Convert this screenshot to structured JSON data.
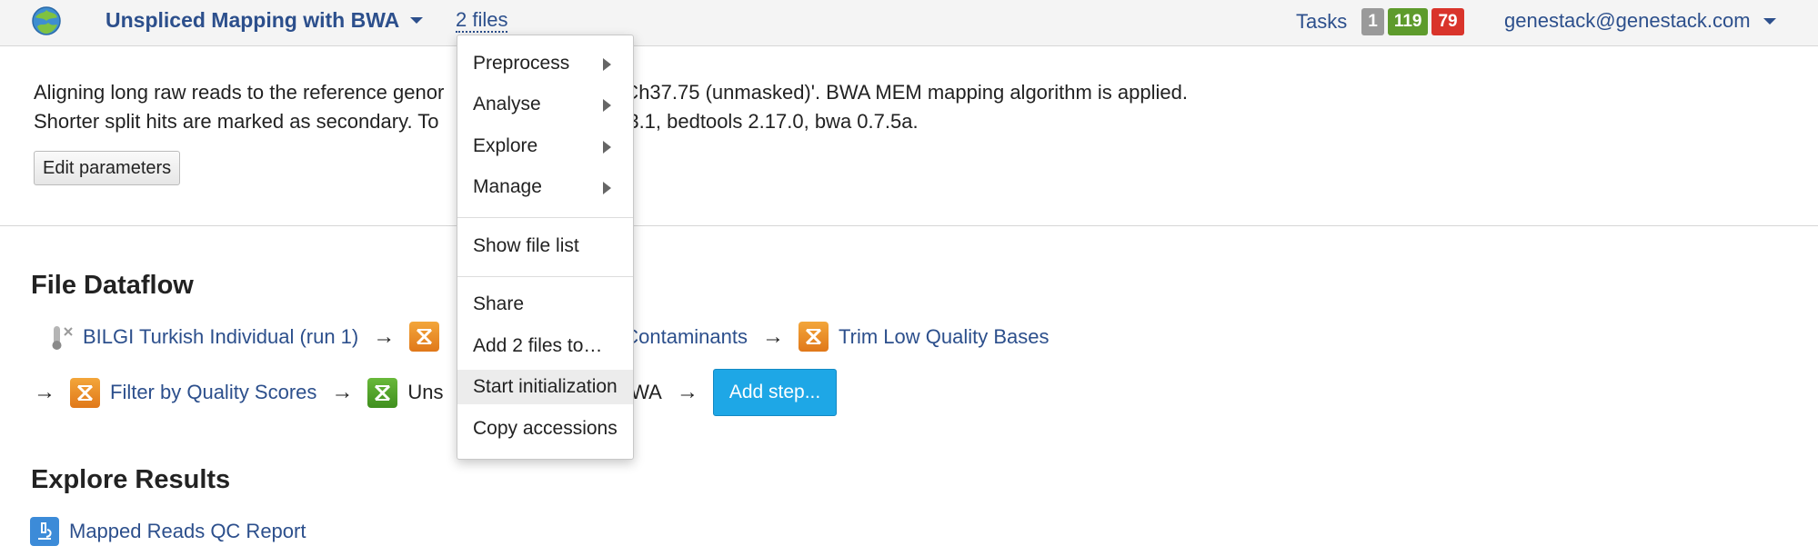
{
  "header": {
    "app_title": "Unspliced Mapping with BWA",
    "files_link": "2 files",
    "tasks_label": "Tasks",
    "task_counts": {
      "queued": "1",
      "done": "119",
      "failed": "79"
    },
    "user_email": "genestack@genestack.com"
  },
  "description": {
    "line1": "Aligning long raw reads to the reference genor                           GRCh37.75 (unmasked)'. BWA MEM mapping algorithm is applied.",
    "line2": "Shorter split hits are marked as secondary. To                               1.3.1, bedtools 2.17.0, bwa 0.7.5a.",
    "edit_button": "Edit parameters"
  },
  "dataflow": {
    "title": "File Dataflow",
    "row1": {
      "source": "BILGI Turkish Individual (run 1)",
      "step2": "Contaminants",
      "step3": "Trim Low Quality Bases"
    },
    "row2": {
      "step1": "Filter by Quality Scores",
      "step2_prefix": "Uns",
      "step2_suffix": "BWA",
      "add_button": "Add step..."
    },
    "arrow": "→"
  },
  "explore": {
    "title": "Explore Results",
    "report_link": "Mapped Reads QC Report"
  },
  "dropdown": {
    "preprocess": "Preprocess",
    "analyse": "Analyse",
    "explore": "Explore",
    "manage": "Manage",
    "show_file_list": "Show file list",
    "share": "Share",
    "add_files": "Add 2 files to…",
    "start_init": "Start initialization",
    "copy_accessions": "Copy accessions"
  },
  "colors": {
    "link": "#2c4f8c",
    "accent_button": "#1ea7e6",
    "badge_gray": "#9a9a9a",
    "badge_green": "#5e9b2c",
    "badge_red": "#d9342b",
    "step_orange": "#e0781a",
    "step_green": "#3f8f1e"
  }
}
